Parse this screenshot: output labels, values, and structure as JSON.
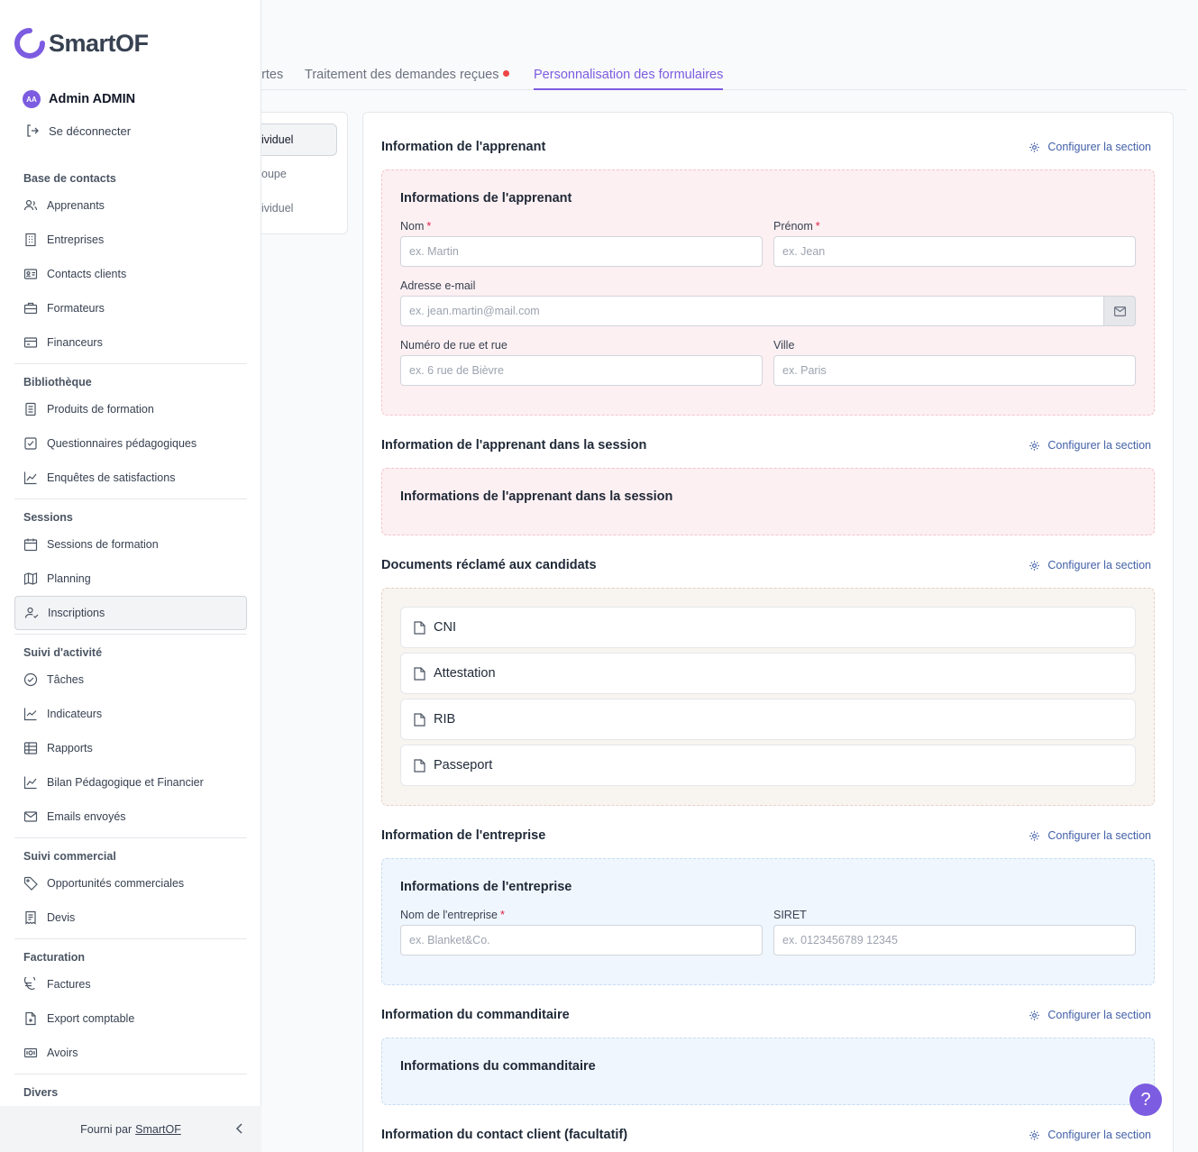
{
  "brand": {
    "name": "SmartOF"
  },
  "user": {
    "initials": "AA",
    "name": "Admin ADMIN",
    "logout_label": "Se déconnecter"
  },
  "nav": {
    "groups": [
      {
        "title": "Base de contacts",
        "items": [
          {
            "label": "Apprenants",
            "icon": "users-icon"
          },
          {
            "label": "Entreprises",
            "icon": "building-icon"
          },
          {
            "label": "Contacts clients",
            "icon": "id-card-icon"
          },
          {
            "label": "Formateurs",
            "icon": "briefcase-icon"
          },
          {
            "label": "Financeurs",
            "icon": "credit-card-icon"
          }
        ]
      },
      {
        "title": "Bibliothèque",
        "items": [
          {
            "label": "Produits de formation",
            "icon": "document-icon"
          },
          {
            "label": "Questionnaires pédagogiques",
            "icon": "checkbox-icon"
          },
          {
            "label": "Enquêtes de satisfactions",
            "icon": "chart-line-icon"
          }
        ]
      },
      {
        "title": "Sessions",
        "items": [
          {
            "label": "Sessions de formation",
            "icon": "calendar-icon"
          },
          {
            "label": "Planning",
            "icon": "map-icon"
          },
          {
            "label": "Inscriptions",
            "icon": "user-check-icon",
            "active": true
          }
        ]
      },
      {
        "title": "Suivi d'activité",
        "items": [
          {
            "label": "Tâches",
            "icon": "check-circle-icon"
          },
          {
            "label": "Indicateurs",
            "icon": "trend-icon"
          },
          {
            "label": "Rapports",
            "icon": "table-icon"
          },
          {
            "label": "Bilan Pédagogique et Financier",
            "icon": "chart-line-icon"
          },
          {
            "label": "Emails envoyés",
            "icon": "mail-icon"
          }
        ]
      },
      {
        "title": "Suivi commercial",
        "items": [
          {
            "label": "Opportunités commerciales",
            "icon": "tag-icon"
          },
          {
            "label": "Devis",
            "icon": "receipt-icon"
          }
        ]
      },
      {
        "title": "Facturation",
        "items": [
          {
            "label": "Factures",
            "icon": "euro-icon"
          },
          {
            "label": "Export comptable",
            "icon": "file-export-icon"
          },
          {
            "label": "Avoirs",
            "icon": "banknote-icon"
          }
        ]
      },
      {
        "title": "Divers",
        "items": []
      }
    ]
  },
  "footer": {
    "prefix": "Fourni par",
    "link": "SmartOF"
  },
  "tabs": [
    {
      "label": "ertes"
    },
    {
      "label": "Traitement des demandes reçues",
      "badge": true
    },
    {
      "label": "Personnalisation des formulaires",
      "active": true
    }
  ],
  "subnav": [
    {
      "label": "ividuel",
      "active": true
    },
    {
      "label": "oupe"
    },
    {
      "label": "ividuel"
    }
  ],
  "config_label": "Configurer la section",
  "sections": {
    "apprenant": {
      "title": "Information de l'apprenant",
      "box_title": "Informations de l'apprenant",
      "nom_label": "Nom",
      "nom_placeholder": "ex. Martin",
      "prenom_label": "Prénom",
      "prenom_placeholder": "ex. Jean",
      "email_label": "Adresse e-mail",
      "email_placeholder": "ex. jean.martin@mail.com",
      "rue_label": "Numéro de rue et rue",
      "rue_placeholder": "ex. 6 rue de Bièvre",
      "ville_label": "Ville",
      "ville_placeholder": "ex. Paris"
    },
    "session": {
      "title": "Information de l'apprenant dans la session",
      "box_title": "Informations de l'apprenant dans la session"
    },
    "documents": {
      "title": "Documents réclamé aux candidats",
      "items": [
        "CNI",
        "Attestation",
        "RIB",
        "Passeport"
      ]
    },
    "entreprise": {
      "title": "Information de l'entreprise",
      "box_title": "Informations de l'entreprise",
      "nom_label": "Nom de l'entreprise",
      "nom_placeholder": "ex. Blanket&Co.",
      "siret_label": "SIRET",
      "siret_placeholder": "ex. 0123456789 12345"
    },
    "commanditaire": {
      "title": "Information du commanditaire",
      "box_title": "Informations du commanditaire"
    },
    "contact": {
      "title": "Information du contact client (facultatif)"
    }
  },
  "help_label": "?",
  "colors": {
    "accent": "#7c5ce0",
    "required": "#e11d48",
    "badge": "#ef4444"
  }
}
